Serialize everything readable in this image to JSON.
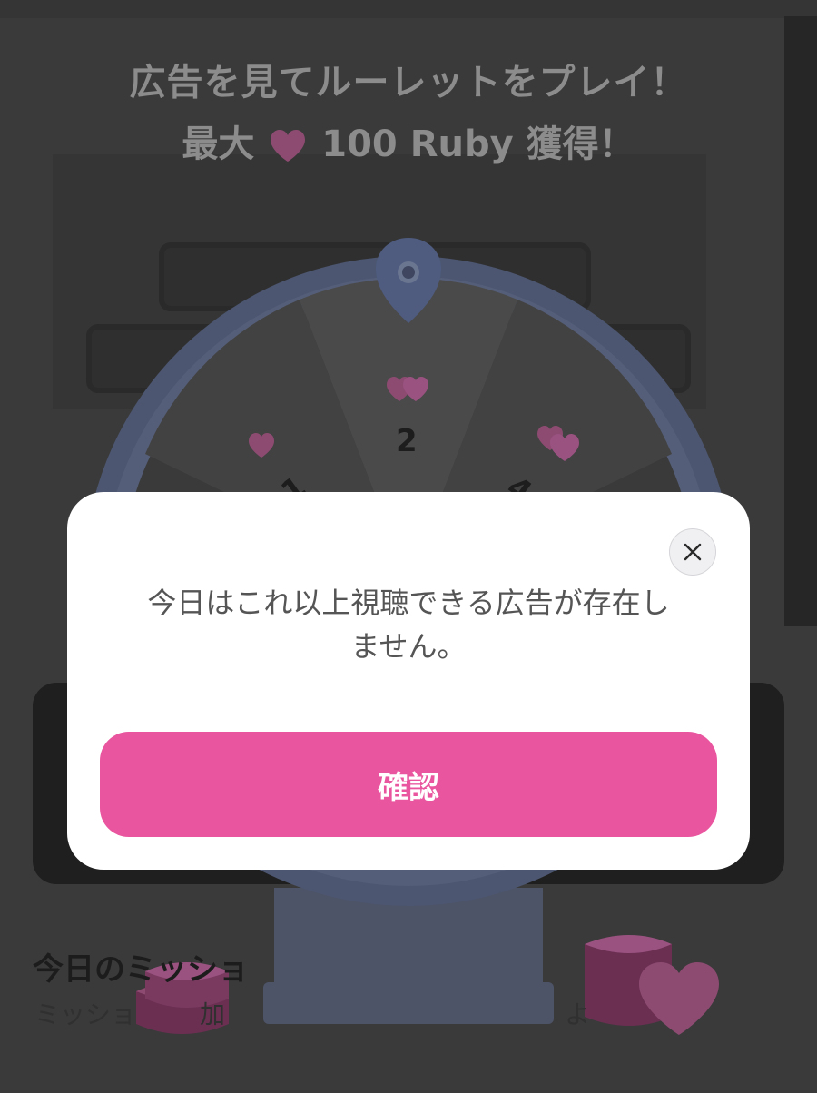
{
  "background": {
    "headline_line1": "広告を見てルーレットをプレイ！",
    "headline_line2_prefix": "最大",
    "headline_line2_suffix": "100 Ruby 獲得！",
    "ruby_icon": "heart-icon",
    "wheel": {
      "segments": [
        {
          "label": "1",
          "icon": "heart-icon"
        },
        {
          "label": "2",
          "icon": "double-heart-icon"
        },
        {
          "label": "4",
          "icon": "heart-stack-icon"
        }
      ]
    },
    "mission": {
      "title": "今日のミッショ",
      "subtitle_start": "ミッショ",
      "subtitle_middle": "加",
      "subtitle_end": "よ"
    }
  },
  "dialog": {
    "message_line1": "今日はこれ以上視聴できる広告が存在し",
    "message_line2": "ません。",
    "confirm_label": "確認",
    "close_icon": "close-icon"
  },
  "colors": {
    "overlay": "#3a3a3a",
    "dialog_bg": "#ffffff",
    "confirm_button": "#e9559e",
    "confirm_text": "#ffffff",
    "heart": "#c94a8d"
  }
}
